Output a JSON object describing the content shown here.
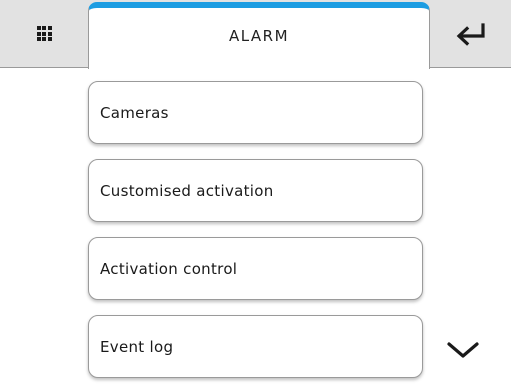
{
  "header": {
    "title": "ALARM",
    "menu_icon": "grid-menu-icon",
    "back_icon": "return-arrow-icon",
    "accent_color": "#1d9de2"
  },
  "menu": {
    "items": [
      {
        "label": "Cameras"
      },
      {
        "label": "Customised activation"
      },
      {
        "label": "Activation control"
      },
      {
        "label": "Event log"
      }
    ],
    "scroll_icon": "chevron-down-icon"
  }
}
